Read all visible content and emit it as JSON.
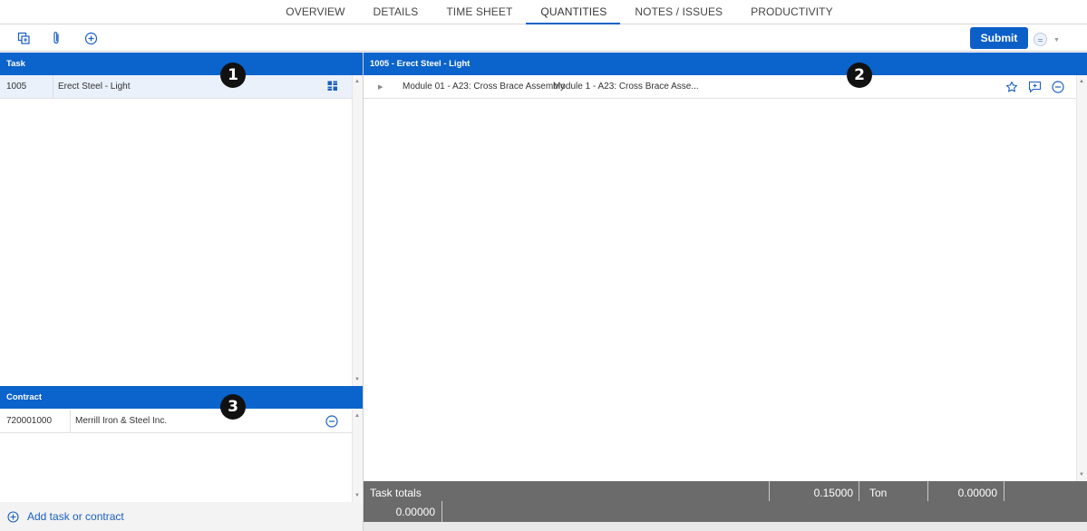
{
  "nav": {
    "tabs": [
      {
        "label": "OVERVIEW"
      },
      {
        "label": "DETAILS"
      },
      {
        "label": "TIME SHEET"
      },
      {
        "label": "QUANTITIES"
      },
      {
        "label": "NOTES / ISSUES"
      },
      {
        "label": "PRODUCTIVITY"
      }
    ],
    "active_tab": "QUANTITIES"
  },
  "toolbar": {
    "icons": [
      "copy-icon",
      "paperclip-icon",
      "add-circle-icon"
    ],
    "submit_label": "Submit",
    "accent_color": "#0d5fc8"
  },
  "task_panel": {
    "header": "Task",
    "rows": [
      {
        "code": "1005",
        "name": "Erect Steel - Light",
        "icon": "grid-view-icon"
      }
    ]
  },
  "contract_panel": {
    "header": "Contract",
    "rows": [
      {
        "code": "720001000",
        "name": "Merrill Iron & Steel Inc.",
        "icon": "minus-circle-icon"
      }
    ]
  },
  "add_link": "Add task or contract",
  "detail_panel": {
    "header": "1005 - Erect Steel - Light",
    "rows": [
      {
        "name": "Module 01 - A23: Cross Brace Assembly",
        "description": "Module 1 - A23: Cross Brace Asse...",
        "icons": [
          "star-icon",
          "add-comment-icon",
          "minus-circle-icon"
        ]
      }
    ]
  },
  "totals": {
    "label": "Task totals",
    "quantity": "0.15000",
    "unit": "Ton",
    "value2": "0.00000",
    "value3": "0.00000"
  },
  "markers": [
    "1",
    "2",
    "3"
  ],
  "colors": {
    "header_blue": "#0b63cc",
    "totals_gray": "#6b6b6b",
    "selected_row": "#eaf1fb"
  }
}
